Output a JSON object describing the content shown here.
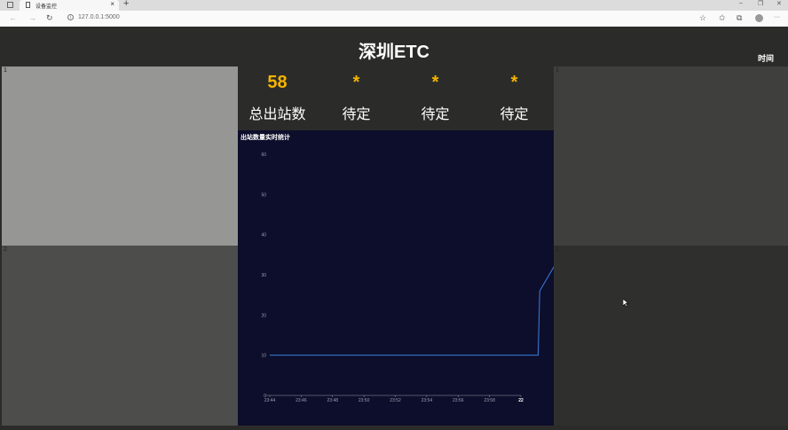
{
  "browser": {
    "tab_title": "设备监控",
    "url": "127.0.0.1:5000",
    "new_tab": "+",
    "close": "×",
    "min": "–",
    "restore": "❐",
    "win_close": "✕",
    "more": "···"
  },
  "header": {
    "title": "深圳ETC",
    "time_label": "时间"
  },
  "panels": {
    "top_left": "1",
    "top_right": "1",
    "bottom_left": "2",
    "bottom_right": "2"
  },
  "stats": [
    {
      "value": "58",
      "caption": "总出站数"
    },
    {
      "value": "*",
      "caption": "待定"
    },
    {
      "value": "*",
      "caption": "待定"
    },
    {
      "value": "*",
      "caption": "待定"
    }
  ],
  "chart_data": {
    "type": "line",
    "title": "出站数量实时统计",
    "xlabel": "",
    "ylabel": "",
    "ylim": [
      0,
      60
    ],
    "yticks": [
      "0",
      "10",
      "20",
      "30",
      "40",
      "50",
      "60"
    ],
    "xticks": [
      "23:44",
      "23:46",
      "23:48",
      "23:50",
      "23:52",
      "23:54",
      "23:56",
      "23:58",
      "22"
    ],
    "series": [
      {
        "x": [
          0,
          8.55,
          8.6,
          9.05
        ],
        "y": [
          10,
          10,
          26,
          32
        ],
        "color": "#3a7fe0"
      }
    ]
  },
  "colors": {
    "accent": "#f4b400",
    "chart_bg": "#0d0e2b",
    "line": "#3a7fe0"
  }
}
